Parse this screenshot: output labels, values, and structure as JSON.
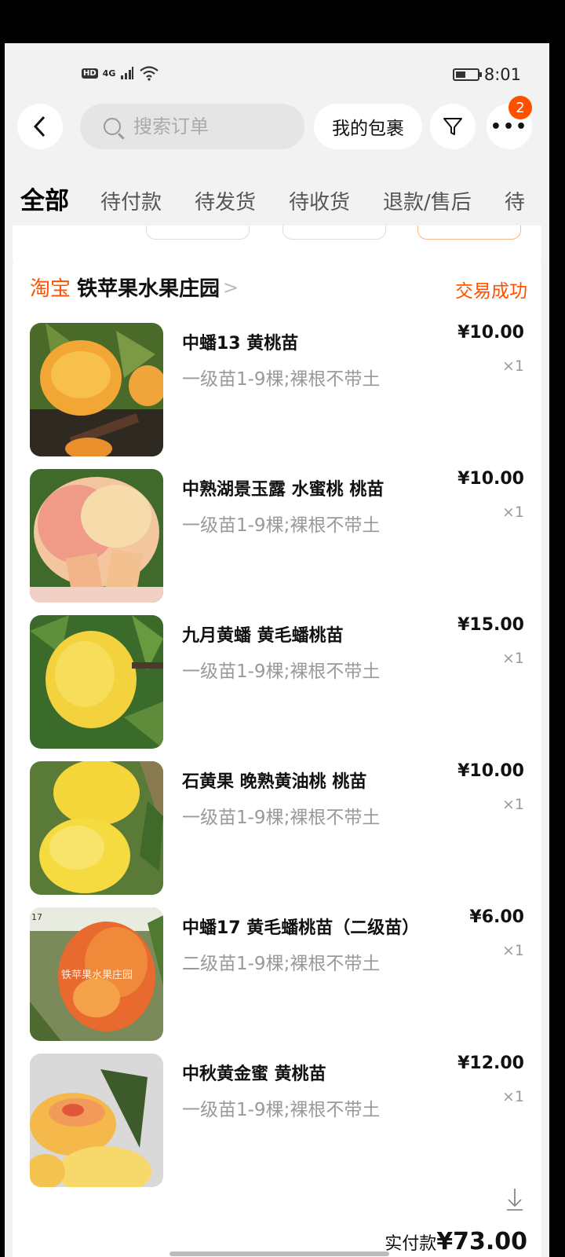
{
  "status_bar": {
    "hd": "HD",
    "signal": "4G",
    "time": "8:01"
  },
  "header": {
    "search_placeholder": "搜索订单",
    "package_label": "我的包裹",
    "more_badge": "2"
  },
  "tabs": [
    "全部",
    "待付款",
    "待发货",
    "待收货",
    "退款/售后",
    "待"
  ],
  "order": {
    "platform": "淘宝",
    "shop_name": "铁苹果水果庄园",
    "chevron": ">",
    "status": "交易成功",
    "items": [
      {
        "title": "中蟠13 黄桃苗",
        "spec": "一级苗1-9棵;裸根不带土",
        "price": "¥10.00",
        "qty": "×1"
      },
      {
        "title": "中熟湖景玉露 水蜜桃 桃苗",
        "spec": "一级苗1-9棵;裸根不带土",
        "price": "¥10.00",
        "qty": "×1"
      },
      {
        "title": "九月黄蟠 黄毛蟠桃苗",
        "spec": "一级苗1-9棵;裸根不带土",
        "price": "¥15.00",
        "qty": "×1"
      },
      {
        "title": "石黄果 晚熟黄油桃 桃苗",
        "spec": "一级苗1-9棵;裸根不带土",
        "price": "¥10.00",
        "qty": "×1"
      },
      {
        "title": "中蟠17 黄毛蟠桃苗（二级苗）",
        "spec": "二级苗1-9棵;裸根不带土",
        "price": "¥6.00",
        "qty": "×1"
      },
      {
        "title": "中秋黄金蜜 黄桃苗",
        "spec": "一级苗1-9棵;裸根不带土",
        "price": "¥12.00",
        "qty": "×1"
      }
    ],
    "total_label": "实付款",
    "total_amount": "¥73.00"
  },
  "thumb_watermarks": {
    "item5_tag": "17",
    "item5_shop": "铁苹果水果庄园"
  }
}
